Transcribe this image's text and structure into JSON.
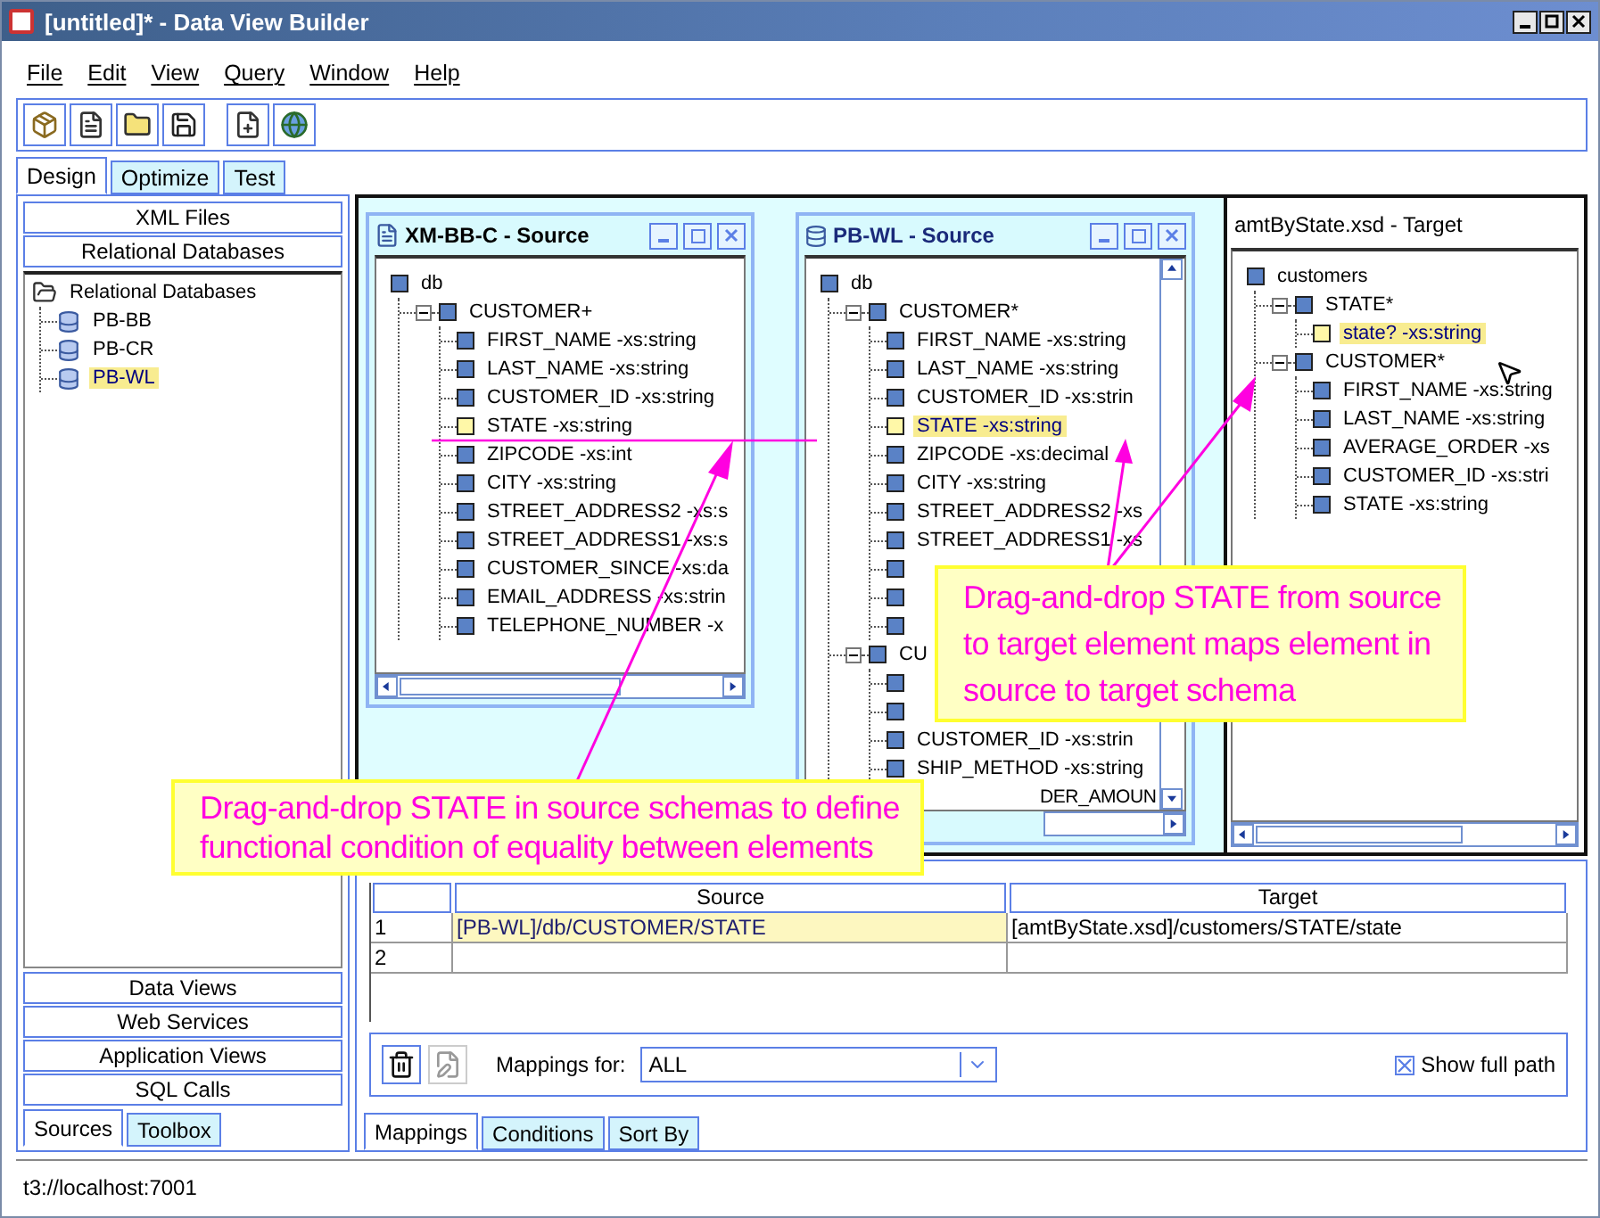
{
  "window": {
    "title": "[untitled]* - Data View Builder"
  },
  "menu": [
    "File",
    "Edit",
    "View",
    "Query",
    "Window",
    "Help"
  ],
  "tabs": [
    {
      "label": "Design",
      "selected": true
    },
    {
      "label": "Optimize",
      "selected": false
    },
    {
      "label": "Test",
      "selected": false
    }
  ],
  "sidebar": {
    "top_buttons": [
      "XML Files",
      "Relational Databases"
    ],
    "tree": [
      {
        "label": "Relational Databases",
        "kind": "folder",
        "selected": false,
        "children": [
          {
            "label": "PB-BB",
            "kind": "database",
            "selected": false
          },
          {
            "label": "PB-CR",
            "kind": "database",
            "selected": false
          },
          {
            "label": "PB-WL",
            "kind": "database",
            "selected": true
          }
        ]
      }
    ],
    "bottom_buttons": [
      "Data Views",
      "Web Services",
      "Application Views",
      "SQL Calls"
    ],
    "tabs": [
      {
        "label": "Sources",
        "selected": true
      },
      {
        "label": "Toolbox",
        "selected": false
      }
    ]
  },
  "sources": [
    {
      "title": "XM-BB-C - Source",
      "kind": "document",
      "tree": [
        {
          "label": "db",
          "kind": "element",
          "selected": false,
          "children": [
            {
              "label": "CUSTOMER+",
              "kind": "element",
              "selected": false,
              "expanded": true,
              "children": [
                {
                  "label": "FIRST_NAME -xs:string",
                  "kind": "element",
                  "selected": false
                },
                {
                  "label": "LAST_NAME -xs:string",
                  "kind": "element",
                  "selected": false
                },
                {
                  "label": "CUSTOMER_ID -xs:string",
                  "kind": "element",
                  "selected": false
                },
                {
                  "label": "STATE -xs:string",
                  "kind": "mapped",
                  "selected": false
                },
                {
                  "label": "ZIPCODE -xs:int",
                  "kind": "element",
                  "selected": false
                },
                {
                  "label": "CITY -xs:string",
                  "kind": "element",
                  "selected": false
                },
                {
                  "label": "STREET_ADDRESS2 -xs:s",
                  "kind": "element",
                  "selected": false
                },
                {
                  "label": "STREET_ADDRESS1 -xs:s",
                  "kind": "element",
                  "selected": false
                },
                {
                  "label": "CUSTOMER_SINCE -xs:da",
                  "kind": "element",
                  "selected": false
                },
                {
                  "label": "EMAIL_ADDRESS -xs:strin",
                  "kind": "element",
                  "selected": false
                },
                {
                  "label": "TELEPHONE_NUMBER -x",
                  "kind": "element",
                  "selected": false
                }
              ]
            }
          ]
        }
      ]
    },
    {
      "title": "PB-WL - Source",
      "kind": "database",
      "tree": [
        {
          "label": "db",
          "kind": "element",
          "selected": false,
          "children": [
            {
              "label": "CUSTOMER*",
              "kind": "element",
              "selected": false,
              "expanded": true,
              "children": [
                {
                  "label": "FIRST_NAME -xs:string",
                  "kind": "element",
                  "selected": false
                },
                {
                  "label": "LAST_NAME -xs:string",
                  "kind": "element",
                  "selected": false
                },
                {
                  "label": "CUSTOMER_ID -xs:strin",
                  "kind": "element",
                  "selected": false
                },
                {
                  "label": "STATE -xs:string",
                  "kind": "mapped",
                  "selected": true
                },
                {
                  "label": "ZIPCODE -xs:decimal",
                  "kind": "element",
                  "selected": false
                },
                {
                  "label": "CITY -xs:string",
                  "kind": "element",
                  "selected": false
                },
                {
                  "label": "STREET_ADDRESS2 -xs",
                  "kind": "element",
                  "selected": false
                },
                {
                  "label": "STREET_ADDRESS1 -xs",
                  "kind": "element",
                  "selected": false
                },
                {
                  "kind": "covered",
                  "selected": false
                },
                {
                  "kind": "covered",
                  "selected": false
                },
                {
                  "kind": "covered",
                  "selected": false
                }
              ]
            },
            {
              "label": "CU",
              "kind": "element",
              "selected": false,
              "expanded": true,
              "children": [
                {
                  "kind": "covered",
                  "selected": false
                },
                {
                  "kind": "covered",
                  "selected": false
                },
                {
                  "label": "CUSTOMER_ID -xs:strin",
                  "kind": "element",
                  "selected": false
                },
                {
                  "label": "SHIP_METHOD -xs:string",
                  "kind": "element",
                  "selected": false
                },
                {
                  "label": "DER_AMOUN",
                  "kind": "tail",
                  "selected": false
                }
              ]
            }
          ]
        }
      ]
    }
  ],
  "target": {
    "title": "amtByState.xsd - Target",
    "tree": [
      {
        "label": "customers",
        "kind": "element",
        "selected": false,
        "children": [
          {
            "label": "STATE*",
            "kind": "element",
            "selected": false,
            "expanded": true,
            "children": [
              {
                "label": "state? -xs:string",
                "kind": "mapped",
                "selected": true
              }
            ]
          },
          {
            "label": "CUSTOMER*",
            "kind": "element",
            "selected": false,
            "expanded": true,
            "children": [
              {
                "label": "FIRST_NAME -xs:string",
                "kind": "element",
                "selected": false
              },
              {
                "label": "LAST_NAME -xs:string",
                "kind": "element",
                "selected": false
              },
              {
                "label": "AVERAGE_ORDER -xs",
                "kind": "element",
                "selected": false
              },
              {
                "label": "CUSTOMER_ID -xs:stri",
                "kind": "element",
                "selected": false
              },
              {
                "label": "STATE -xs:string",
                "kind": "element",
                "selected": false
              }
            ]
          }
        ]
      }
    ]
  },
  "mappings": {
    "columns": [
      "Source",
      "Target"
    ],
    "rows": [
      {
        "number": "1",
        "cells": [
          "[PB-WL]/db/CUSTOMER/STATE",
          "[amtByState.xsd]/customers/STATE/state"
        ],
        "selected": true
      },
      {
        "number": "2",
        "selected": false
      }
    ],
    "filter_label": "Mappings for:",
    "filter_value": "ALL",
    "full_path": {
      "label": "Show full path",
      "checked": true
    }
  },
  "bottom_tabs": [
    {
      "label": "Mappings",
      "selected": true
    },
    {
      "label": "Conditions",
      "selected": false
    },
    {
      "label": "Sort By",
      "selected": false
    }
  ],
  "status_bar": "t3://localhost:7001",
  "callouts": [
    {
      "lines": [
        "Drag-and-drop STATE in source schemas to define",
        "functional condition of equality between elements"
      ]
    },
    {
      "lines": [
        "Drag-and-drop STATE from source",
        "to target element maps element in",
        "source to target schema"
      ]
    }
  ]
}
